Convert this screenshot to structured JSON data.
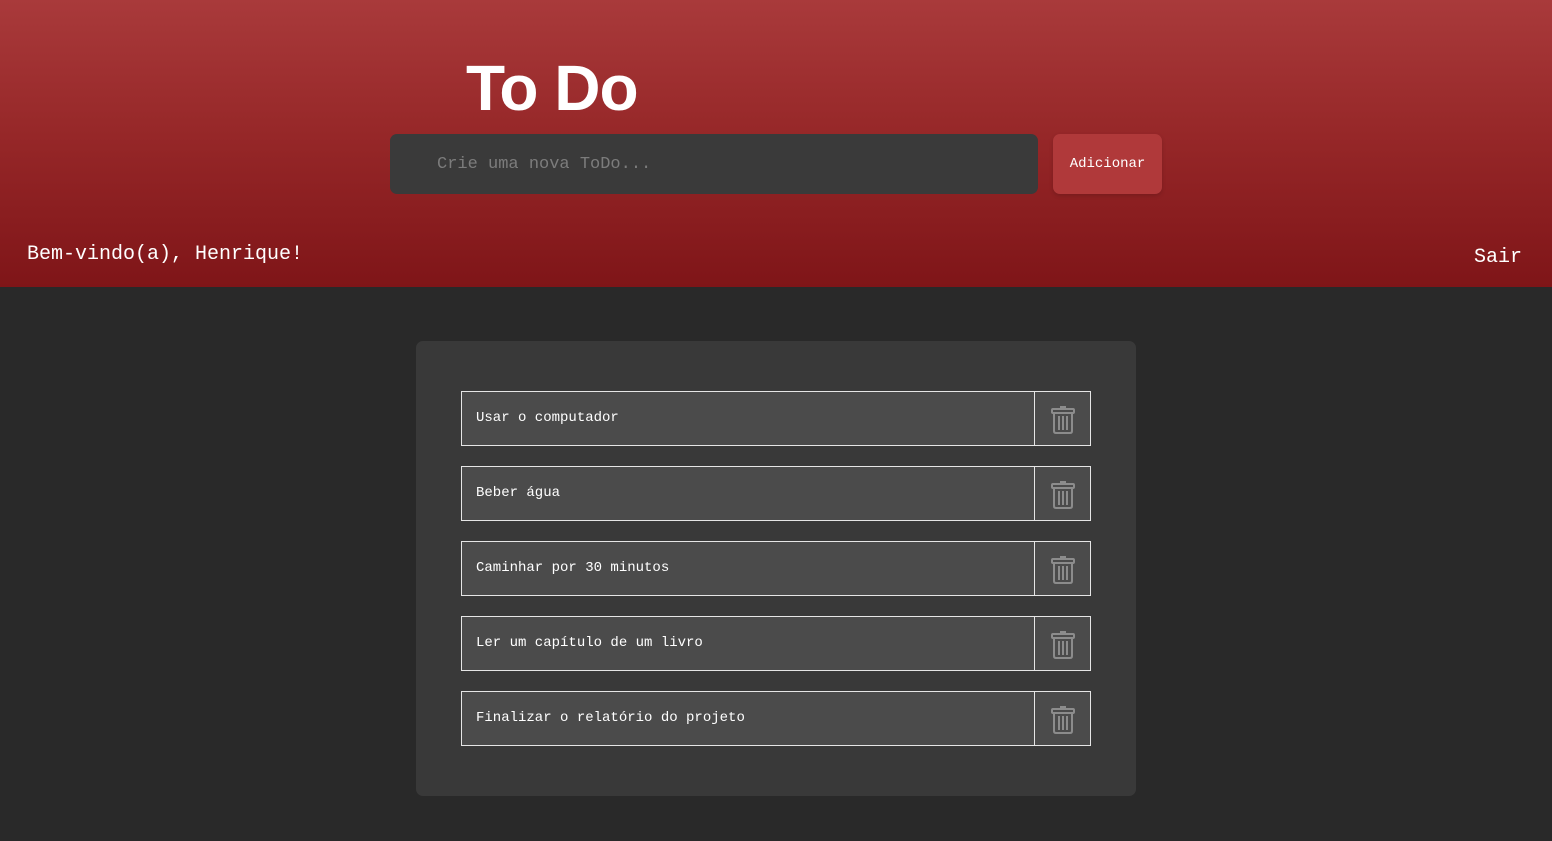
{
  "header": {
    "title": "To Do",
    "input_placeholder": "Crie uma nova ToDo...",
    "add_label": "Adicionar",
    "welcome": "Bem-vindo(a), Henrique!",
    "logout_label": "Sair"
  },
  "todos": [
    {
      "text": "Usar o computador",
      "icon": "trash-icon"
    },
    {
      "text": "Beber água",
      "icon": "trash-icon"
    },
    {
      "text": "Caminhar por 30 minutos",
      "icon": "trash-icon"
    },
    {
      "text": "Ler um capítulo de um livro",
      "icon": "trash-icon"
    },
    {
      "text": "Finalizar o relatório do projeto",
      "icon": "trash-icon"
    }
  ],
  "colors": {
    "header_top": "#a93a3b",
    "header_bottom": "#7f1518",
    "accent_button": "#b0393a",
    "page_background": "#292929",
    "panel_background": "#393939",
    "item_background": "#4b4b4b"
  }
}
